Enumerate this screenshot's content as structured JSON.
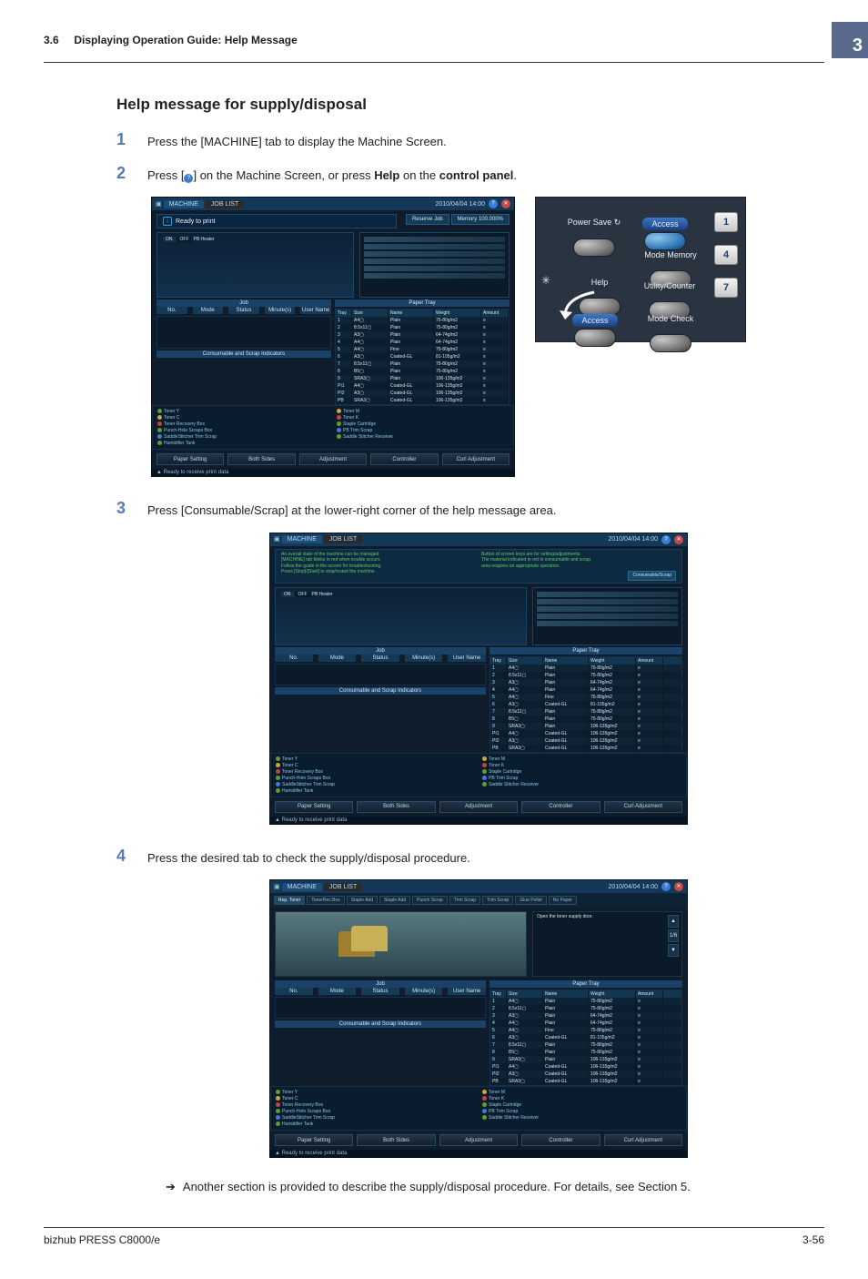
{
  "header": {
    "section_no": "3.6",
    "section_title": "Displaying Operation Guide: Help Message",
    "chapter_tab": "3"
  },
  "title": "Help message for supply/disposal",
  "steps": {
    "s1": {
      "num": "1",
      "text": "Press the [MACHINE] tab to display the Machine Screen."
    },
    "s2": {
      "num": "2",
      "pre": "Press [",
      "post": "] on the Machine Screen, or press ",
      "help": "Help",
      "on": " on the ",
      "panel": "control panel",
      "end": "."
    },
    "s3": {
      "num": "3",
      "text": "Press [Consumable/Scrap] at the lower-right corner of the help message area."
    },
    "s4": {
      "num": "4",
      "text": "Press the desired tab to check the supply/disposal procedure."
    }
  },
  "note": "Another section is provided to describe the supply/disposal procedure. For details, see Section 5.",
  "footer": {
    "model": "bizhub PRESS C8000/e",
    "page": "3-56"
  },
  "screen_common": {
    "tabs": {
      "machine": "MACHINE",
      "joblist": "JOB LIST"
    },
    "datetime": "2010/04/04 14:00",
    "ready": "Ready to print",
    "reserve_job": "Reserve Job",
    "memory_label": "Memory",
    "memory_value": "100.000%",
    "pb_heater": "PB Heater",
    "on": "ON",
    "off": "OFF",
    "job_band": "Job",
    "paper_band": "Paper Tray",
    "job_cols": [
      "No.",
      "Mode",
      "Status",
      "Minute(s)",
      "User Name"
    ],
    "consumable_band": "Consumable and Scrap Indicators",
    "indicators_left": [
      "Toner Y",
      "Toner C",
      "Toner Recovery Box",
      "Punch-Hole Scraps Box",
      "SaddleStitcher Trim Scrap",
      "Humidifier Tank"
    ],
    "indicators_right": [
      "Toner M",
      "Toner K",
      "Staple Cartridge",
      "PB Trim Scrap",
      "Saddle Stitcher Receiver",
      ""
    ],
    "bottom_buttons": [
      "Paper Setting",
      "Both Sides",
      "Adjustment",
      "Controller",
      "Curl Adjustment"
    ],
    "status_ready": "Ready to receive print data",
    "paper_head": [
      "Tray",
      "Size",
      "Name",
      "Weight",
      "Amount"
    ],
    "paper_rows": [
      [
        "1",
        "A4▢",
        "Plain",
        "75-80g/m2",
        "≡"
      ],
      [
        "2",
        "8.5x11▢",
        "Plain",
        "75-80g/m2",
        "≡"
      ],
      [
        "3",
        "A3▢",
        "Plain",
        "64-74g/m2",
        "≡"
      ],
      [
        "4",
        "A4▢",
        "Plain",
        "64-74g/m2",
        "≡"
      ],
      [
        "5",
        "A4▢",
        "Fine",
        "75-80g/m2",
        "≡"
      ],
      [
        "6",
        "A3▢",
        "Coated-GL",
        "81-105g/m2",
        "≡"
      ],
      [
        "7",
        "8.5x11▢",
        "Plain",
        "75-80g/m2",
        "≡"
      ],
      [
        "8",
        "B5▢",
        "Plain",
        "75-80g/m2",
        "≡"
      ],
      [
        "9",
        "SRA3▢",
        "Plain",
        "106-135g/m2",
        "≡"
      ]
    ],
    "paper_rows2": [
      [
        "PI1",
        "A4▢",
        "Coated-GL",
        "106-135g/m2",
        "≡"
      ],
      [
        "PI2",
        "A3▢",
        "Coated-GL",
        "106-135g/m2",
        "≡"
      ],
      [
        "PB",
        "SRA3▢",
        "Coated-GL",
        "106-135g/m2",
        "≡"
      ]
    ]
  },
  "control_panel": {
    "power_save": "Power Save",
    "access_btn": "Access",
    "mode_memory": "Mode Memory",
    "help": "Help",
    "utility_counter": "Utility/Counter",
    "access_label": "Access",
    "mode_check": "Mode Check",
    "keys": [
      "1",
      "4",
      "7"
    ]
  },
  "help_overlay": {
    "left_lines": [
      "An overall state of the machine can be managed.",
      "[MACHINE] tab blinks in red when trouble occurs.",
      "Follow the guide in the screen for troubleshooting.",
      "Press [Stop]/[Start] to stop/restart the machine."
    ],
    "right_lines": [
      "Button of screen keys are for setting/adjustments.",
      "The material indicated in red in consumable and scrap",
      "area requires an appropriate operation."
    ],
    "consumable_btn": "Consumable/Scrap"
  },
  "step4": {
    "tabs": [
      "Rep. Toner",
      "TonerRec.Box",
      "Staple Add",
      "Staple Add",
      "Punch Scrap",
      "Trim Scrap",
      "Trim Scrap",
      "Glue Pellet",
      "No Paper"
    ],
    "instruction": "Open the toner supply door.",
    "page_now": "1",
    "page_total": "6"
  }
}
